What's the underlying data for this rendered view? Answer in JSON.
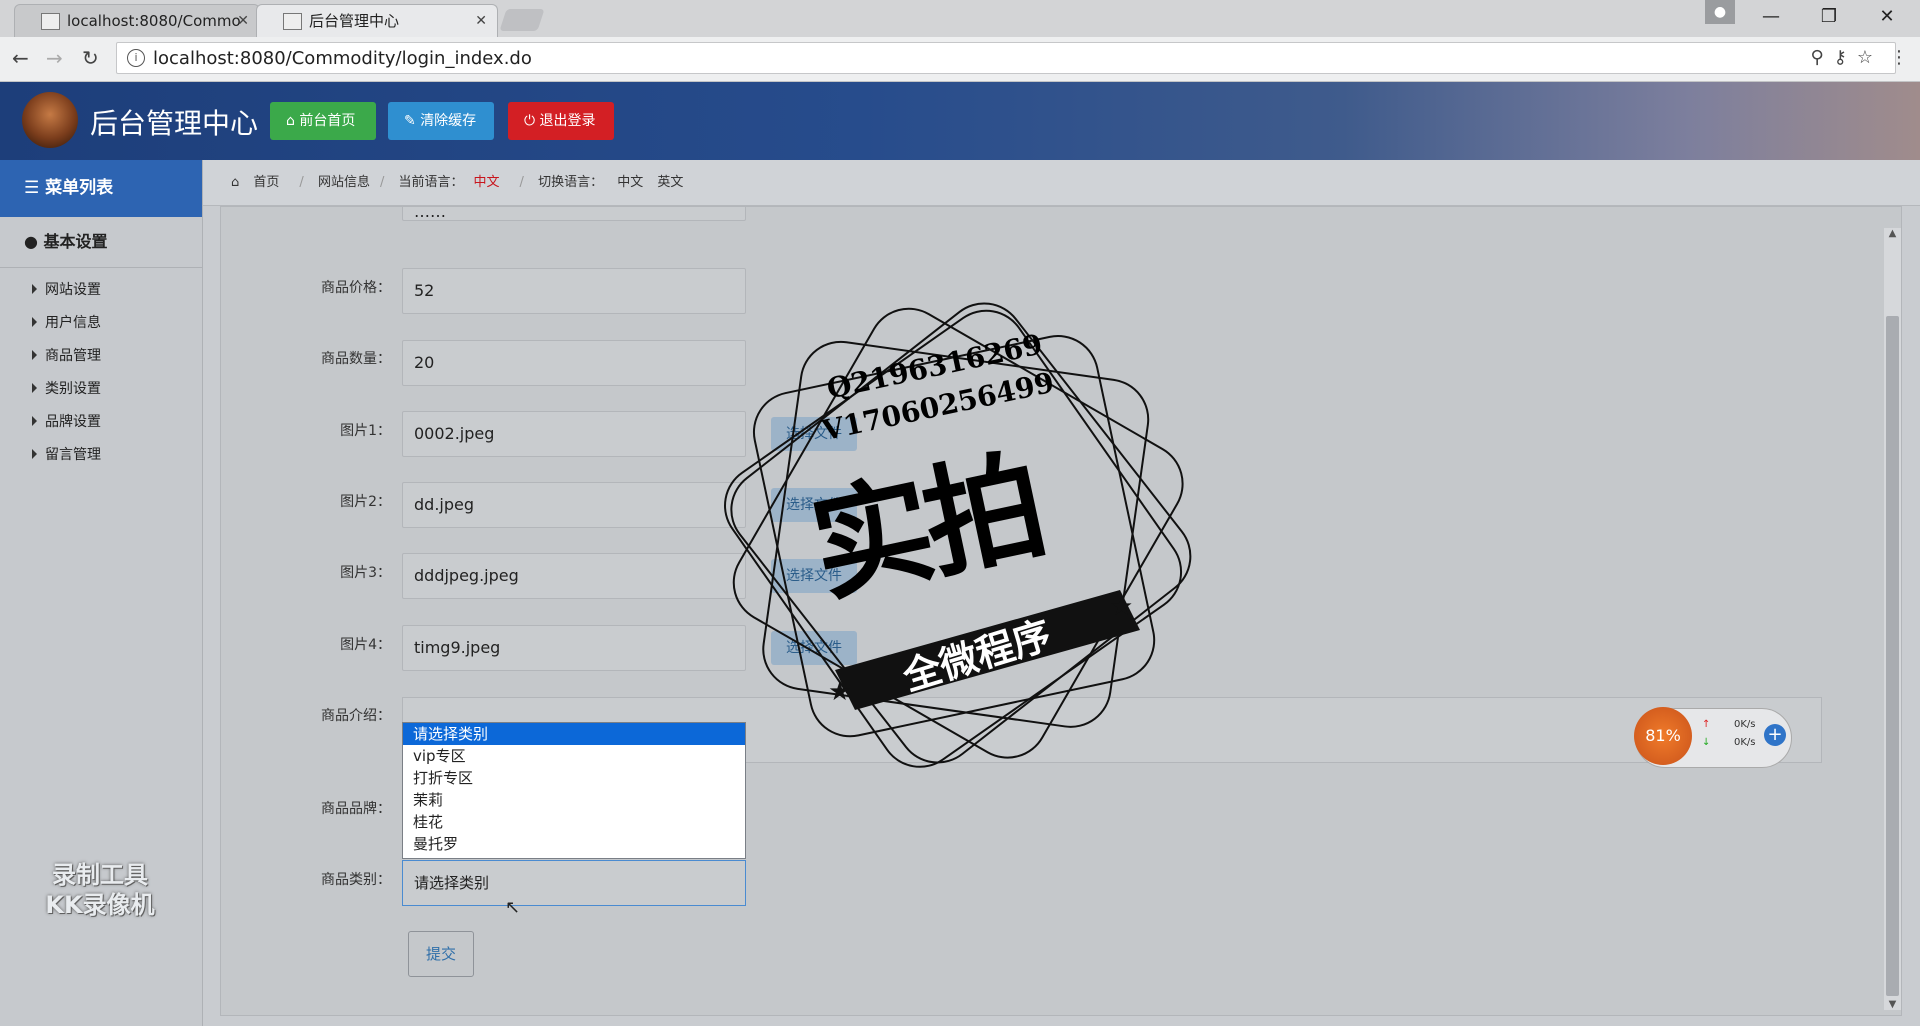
{
  "browser": {
    "tabs": [
      {
        "title": "localhost:8080/Commo"
      },
      {
        "title": "后台管理中心"
      }
    ],
    "url": "localhost:8080/Commodity/login_index.do"
  },
  "header": {
    "title": "后台管理中心",
    "buttons": {
      "front": "前台首页",
      "clear": "清除缓存",
      "logout": "退出登录"
    }
  },
  "sidebar": {
    "heading": "菜单列表",
    "group": "基本设置",
    "items": [
      {
        "label": "网站设置"
      },
      {
        "label": "用户信息"
      },
      {
        "label": "商品管理"
      },
      {
        "label": "类别设置"
      },
      {
        "label": "品牌设置"
      },
      {
        "label": "留言管理"
      }
    ],
    "watermark_line1": "录制工具",
    "watermark_line2": "KK录像机"
  },
  "breadcrumb": {
    "home": "首页",
    "site_info": "网站信息",
    "current_lang_label": "当前语言：",
    "current_lang": "中文",
    "switch_label": "切换语言：",
    "lang_cn": "中文",
    "lang_en": "英文"
  },
  "form": {
    "top_partial_value": "……",
    "price_label": "商品价格：",
    "price_value": "52",
    "qty_label": "商品数量：",
    "qty_value": "20",
    "img1_label": "图片1：",
    "img1_value": "0002.jpeg",
    "img2_label": "图片2：",
    "img2_value": "dd.jpeg",
    "img3_label": "图片3：",
    "img3_value": "dddjpeg.jpeg",
    "img4_label": "图片4：",
    "img4_value": "timg9.jpeg",
    "file_button": "选择文件",
    "intro_label": "商品介绍：",
    "brand_label": "商品品牌：",
    "category_label": "商品类别：",
    "category_value": "请选择类别",
    "dropdown_options": [
      "请选择类别",
      "vip专区",
      "打折专区",
      "茉莉",
      "桂花",
      "曼托罗"
    ],
    "submit": "提交"
  },
  "stamp": {
    "line1": "Q2196316269",
    "line2": "V17060256499",
    "big": "实拍",
    "banner": "全微程序"
  },
  "net_widget": {
    "percent": "81%",
    "up": "0K/s",
    "down": "0K/s"
  }
}
